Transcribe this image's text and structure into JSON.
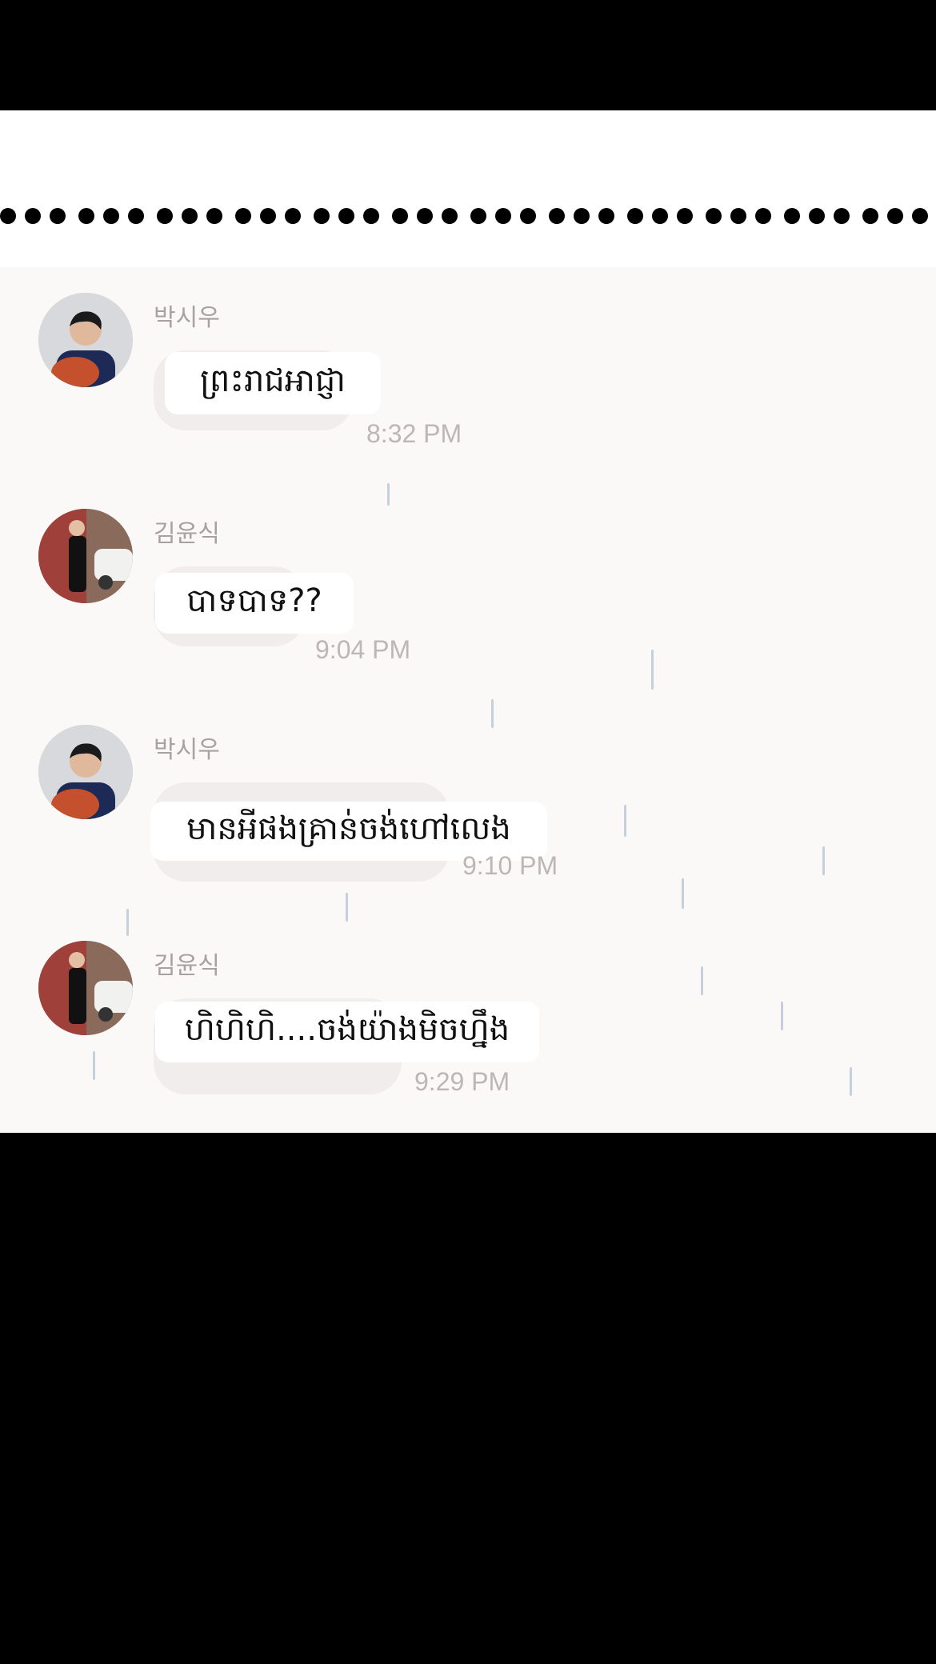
{
  "messages": [
    {
      "sender": "박시우",
      "text": "ព្រះរាជអាជ្ញា",
      "time": "8:32 PM",
      "avatar": "man-with-basketball-avatar"
    },
    {
      "sender": "김윤식",
      "text": "បាទបាទ??",
      "time": "9:04 PM",
      "avatar": "man-in-suit-avatar"
    },
    {
      "sender": "박시우",
      "text": "មានអីផងគ្រាន់ចង់ហៅលេង",
      "time": "9:10 PM",
      "avatar": "man-with-basketball-avatar"
    },
    {
      "sender": "김윤식",
      "text": "ហិហិហិ....ចង់យ៉ាងមិចហ្នឹង",
      "time": "9:29 PM",
      "avatar": "man-in-suit-avatar"
    }
  ],
  "colors": {
    "chat_background": "#fbf8f8",
    "bubble": "#ffffff",
    "umbrella": "#c9d8ee"
  }
}
